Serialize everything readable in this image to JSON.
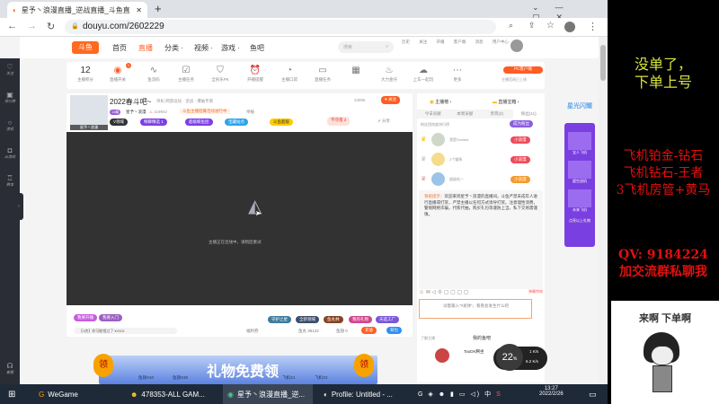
{
  "browser": {
    "tab_title": "星予丶浪漫直播_逆战直播_斗鱼直",
    "url": "douyu.com/2602229",
    "new_tab": "+"
  },
  "nav": {
    "items": [
      "首页",
      "直播",
      "分类 ·",
      "视频 ·",
      "游戏 ·",
      "鱼吧"
    ],
    "search_placeholder": "搜索",
    "icons": [
      "历史",
      "关注",
      "开播",
      "客户端",
      "消息",
      "用户中心"
    ],
    "badges": [
      "2",
      "1"
    ]
  },
  "sidebar": [
    "关注",
    "排行榜",
    "游戏",
    "云游戏",
    "赛事",
    "客服"
  ],
  "toolbar": {
    "points": "12",
    "points_label": "主播积分",
    "items": [
      "直播开关",
      "鱼流码",
      "主播任务",
      "全民乐PK",
      "开播提醒",
      "主播口袋",
      "直播任务",
      "",
      "大力金仔",
      "上车一起玩",
      "更多"
    ],
    "badge": "1",
    "pc_btn": "PC客户端",
    "pc_sub": "主播官网已上线"
  },
  "streamer": {
    "title": "2022春斗吧~",
    "category": "单机 网游竞技 · 逆战 · 爆破专家",
    "level": "13级",
    "name": "星予丶浪漫",
    "hot": "119942",
    "notice": "斗鱼主播招募活动进行中",
    "report": "举报",
    "follow_count": "34955",
    "follow": "关注",
    "share": "分享",
    "pk": "不守夜 2",
    "avatar_tag": "星予丶浪漫",
    "badges": [
      "V领域",
      "畅聊精选 1",
      "超级鲸鱼团",
      "宝藏站点",
      "斗鱼超级"
    ]
  },
  "player": {
    "status": "主播正在连线中，请稍后重试"
  },
  "gifts": {
    "left": [
      "我要开播",
      "我要入门"
    ],
    "right": [
      "守护之星",
      "全新领域",
      "鱼丸林",
      "我的礼物",
      "天选工厂"
    ],
    "chat_notice": "【1房】你可能错过了 ¥X501",
    "controls": [
      "福利券",
      "鱼丸 36122",
      "鱼翅 0"
    ],
    "btn1": "充值",
    "btn2": "背包"
  },
  "banner": {
    "title": "礼物免费领",
    "lead": "领",
    "items": [
      "鱼翅X10",
      "鱼翅X30",
      "飞机X1",
      "飞机X2"
    ]
  },
  "right_panel": {
    "tab_top": [
      "主播榜",
      "直播宝箱"
    ],
    "tabs": [
      "今日贡献",
      "本周贡献",
      "贵宾(2)",
      "粉丝(11)"
    ],
    "fans_label": "粉丝团热度排行榜",
    "fans_btn": "成为粉丝",
    "ranks": [
      {
        "name": "我是Sonidia",
        "badge": "小浪漫"
      },
      {
        "name": "2个猫咪",
        "badge": "小浪漫"
      },
      {
        "name": "超级吃一",
        "badge": "小浪漫"
      }
    ],
    "sys_label": "系统提示：",
    "sys_msg": "欢迎来到星予丶浪漫的直播间。斗鱼严禁未成年人进行直播或打赏，严禁主播以任何方式诱导打赏。注意理性消费，警惕网络诈骗，代练代抽，购买礼包等谨防上当，私下交易需谨慎。",
    "input_placeholder": "试着输入“#发弹”，看看会发生什么吧",
    "send_hint": "弹幕特效",
    "fanclub": "了解主播",
    "mine": "我的鱼吧",
    "user": "TaoDK腾坐",
    "count": "64"
  },
  "net": {
    "pct": "22",
    "unit": "%",
    "up": "1",
    "down": "6.2",
    "speed_unit": "K/s"
  },
  "ad": {
    "title": "星光闪耀",
    "items": [
      "宝人飞机",
      "超空战机",
      "未来飞机"
    ],
    "cta": "点亮以上礼物"
  },
  "taskbar": {
    "apps": [
      "WeGame",
      "478353-ALL GAM...",
      "星予丶浪漫直播_逆...",
      "Profile: Untitled - ..."
    ],
    "time": "13:27",
    "date": "2022/2/26",
    "ime": "中"
  },
  "overlay": {
    "line1": "没单了，",
    "line2": "下单上号",
    "offers": [
      "飞机铂金-钻石",
      "飞机钻石-王者",
      "3飞机房管+黄马"
    ],
    "qq": "QV:  9184224",
    "contact": "加交流群私聊我",
    "meme_caption": "来啊 下单啊"
  },
  "colors": {
    "brand": "#ff5d23",
    "purple": "#7b3fe4",
    "overlay_yellow": "#d8e040",
    "overlay_red": "#e01010"
  }
}
